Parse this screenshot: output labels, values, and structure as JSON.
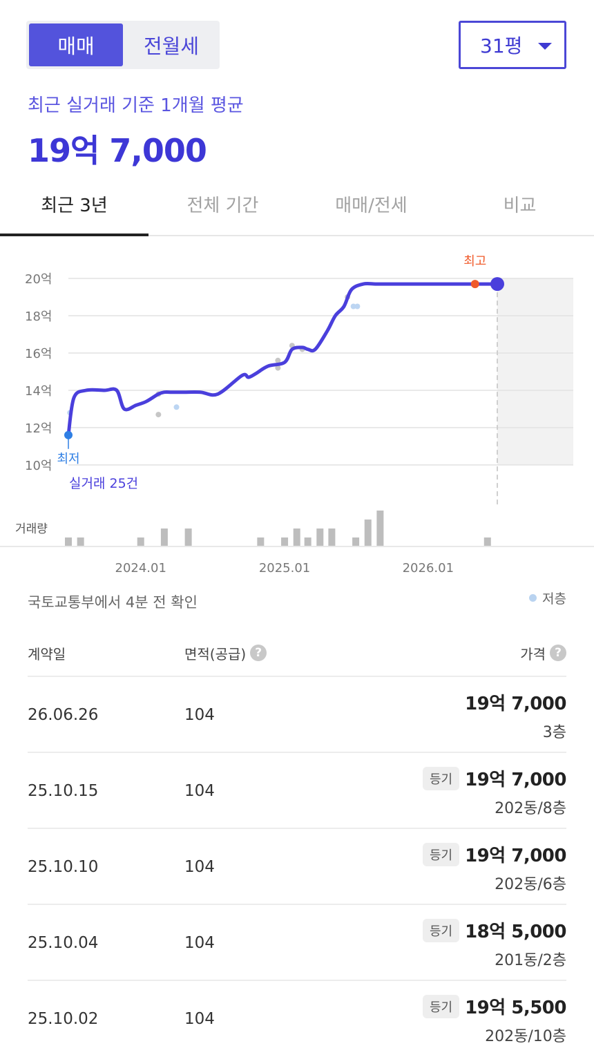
{
  "segment": {
    "active": "매매",
    "other": "전월세"
  },
  "size_select": {
    "value": "31평"
  },
  "summary": {
    "label": "최근 실거래 기준 1개월 평균",
    "price": "19억 7,000"
  },
  "tabs": [
    "최근 3년",
    "전체 기간",
    "매매/전세",
    "비교"
  ],
  "chart_data": {
    "type": "line",
    "title": "",
    "xlabel": "",
    "ylabel": "",
    "y_tick_labels": [
      "20억",
      "18억",
      "16억",
      "14억",
      "12억",
      "10억"
    ],
    "y_ticks": [
      20,
      18,
      16,
      14,
      12,
      10
    ],
    "ylim": [
      10,
      20
    ],
    "x_tick_labels": [
      "2024.01",
      "2025.01",
      "2026.01"
    ],
    "x_ticks": [
      "2024-01",
      "2025-01",
      "2026-01"
    ],
    "grid": true,
    "series": [
      {
        "x": [
          "2023-07-01",
          "2023-07-15",
          "2023-08-15",
          "2023-10-01",
          "2023-11-01",
          "2023-11-20",
          "2023-12-20",
          "2024-01-15",
          "2024-02-15",
          "2024-03-01",
          "2024-03-20",
          "2024-04-20",
          "2024-06-01",
          "2024-07-15",
          "2024-09-15",
          "2024-10-01",
          "2024-10-20",
          "2024-11-20",
          "2025-01-01",
          "2025-01-20",
          "2025-02-15",
          "2025-03-01",
          "2025-03-20",
          "2025-04-20",
          "2025-05-10",
          "2025-06-01",
          "2025-06-20",
          "2025-07-20",
          "2025-08-20",
          "2025-09-20",
          "2025-10-10",
          "2026-01-15",
          "2026-04-15",
          "2026-06-01",
          "2026-06-26"
        ],
        "values": [
          11.6,
          13.6,
          14.0,
          14.0,
          14.0,
          13.0,
          13.2,
          13.4,
          13.8,
          13.9,
          13.9,
          13.9,
          13.9,
          13.8,
          14.8,
          14.7,
          14.9,
          15.3,
          15.5,
          16.2,
          16.3,
          16.2,
          16.2,
          17.2,
          18.0,
          18.5,
          19.4,
          19.7,
          19.7,
          19.7,
          19.7,
          19.7,
          19.7,
          19.7,
          19.7
        ]
      }
    ],
    "dots_x": [
      "2023-07-05",
      "2024-02-15",
      "2024-02-15",
      "2024-04-01",
      "2024-12-15",
      "2024-12-15",
      "2025-01-20",
      "2025-02-15",
      "2025-06-10",
      "2025-06-25",
      "2025-07-05"
    ],
    "dots_y": [
      12.8,
      13.8,
      12.7,
      13.1,
      15.6,
      15.2,
      16.4,
      16.2,
      19.0,
      18.5,
      18.5
    ],
    "markers": {
      "low_label": "최저",
      "high_label": "최고",
      "trades_label": "실거래 25건"
    },
    "volume": {
      "label": "거래량",
      "x": [
        "2023-07-01",
        "2023-08-01",
        "2024-01-01",
        "2024-03-01",
        "2024-05-01",
        "2024-11-01",
        "2025-01-01",
        "2025-02-01",
        "2025-03-01",
        "2025-04-01",
        "2025-05-01",
        "2025-07-01",
        "2025-08-01",
        "2025-09-01",
        "2026-06-01"
      ],
      "values": [
        1,
        1,
        1,
        2,
        2,
        1,
        1,
        2,
        1,
        2,
        2,
        1,
        3,
        4,
        1
      ]
    },
    "colors": {
      "line": "#4a3fdc",
      "low": "#2f7fe4",
      "high": "#f05a2a",
      "dot_gray": "#c6c6c6",
      "dot_blue": "#bcd5f2",
      "volume": "#bdbdbd"
    }
  },
  "source_text": "국토교통부에서 4분 전 확인",
  "legend_text": "저층",
  "table": {
    "headers": {
      "date": "계약일",
      "area": "면적(공급)",
      "price": "가격"
    },
    "rows": [
      {
        "date": "26.06.26",
        "area": "104",
        "badge": "",
        "price": "19억 7,000",
        "floor": "3층"
      },
      {
        "date": "25.10.15",
        "area": "104",
        "badge": "등기",
        "price": "19억 7,000",
        "floor": "202동/8층"
      },
      {
        "date": "25.10.10",
        "area": "104",
        "badge": "등기",
        "price": "19억 7,000",
        "floor": "202동/6층"
      },
      {
        "date": "25.10.04",
        "area": "104",
        "badge": "등기",
        "price": "18억 5,000",
        "floor": "201동/2층"
      },
      {
        "date": "25.10.02",
        "area": "104",
        "badge": "등기",
        "price": "19억 5,500",
        "floor": "202동/10층"
      }
    ]
  }
}
